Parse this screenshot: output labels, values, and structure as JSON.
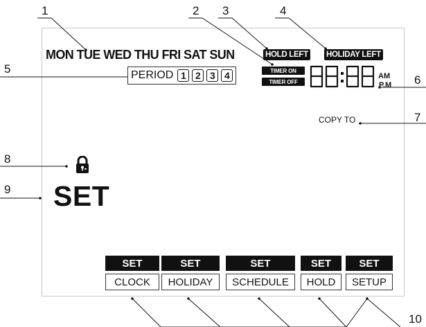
{
  "callouts": [
    "1",
    "2",
    "3",
    "4",
    "5",
    "6",
    "7",
    "8",
    "9",
    "10"
  ],
  "days": [
    "MON",
    "TUE",
    "WED",
    "THU",
    "FRI",
    "SAT",
    "SUN"
  ],
  "hold_left": "HOLD LEFT",
  "holiday_left": "HOLIDAY LEFT",
  "period": {
    "label": "PERIOD",
    "numbers": [
      "1",
      "2",
      "3",
      "4"
    ]
  },
  "timer_on": "TIMER ON",
  "timer_off": "TIMER OFF",
  "clock": {
    "am": "AM",
    "pm": "P.M"
  },
  "copy_to": "COPY TO",
  "lock_icon": "padlock-icon",
  "set_label": "SET",
  "buttons": [
    {
      "top": "SET",
      "bottom": "CLOCK"
    },
    {
      "top": "SET",
      "bottom": "HOLIDAY"
    },
    {
      "top": "SET",
      "bottom": "SCHEDULE"
    },
    {
      "top": "SET",
      "bottom": "HOLD"
    },
    {
      "top": "SET",
      "bottom": "SETUP"
    }
  ],
  "colors": {
    "ink": "#111111",
    "panel_border": "#c8c8c8"
  }
}
